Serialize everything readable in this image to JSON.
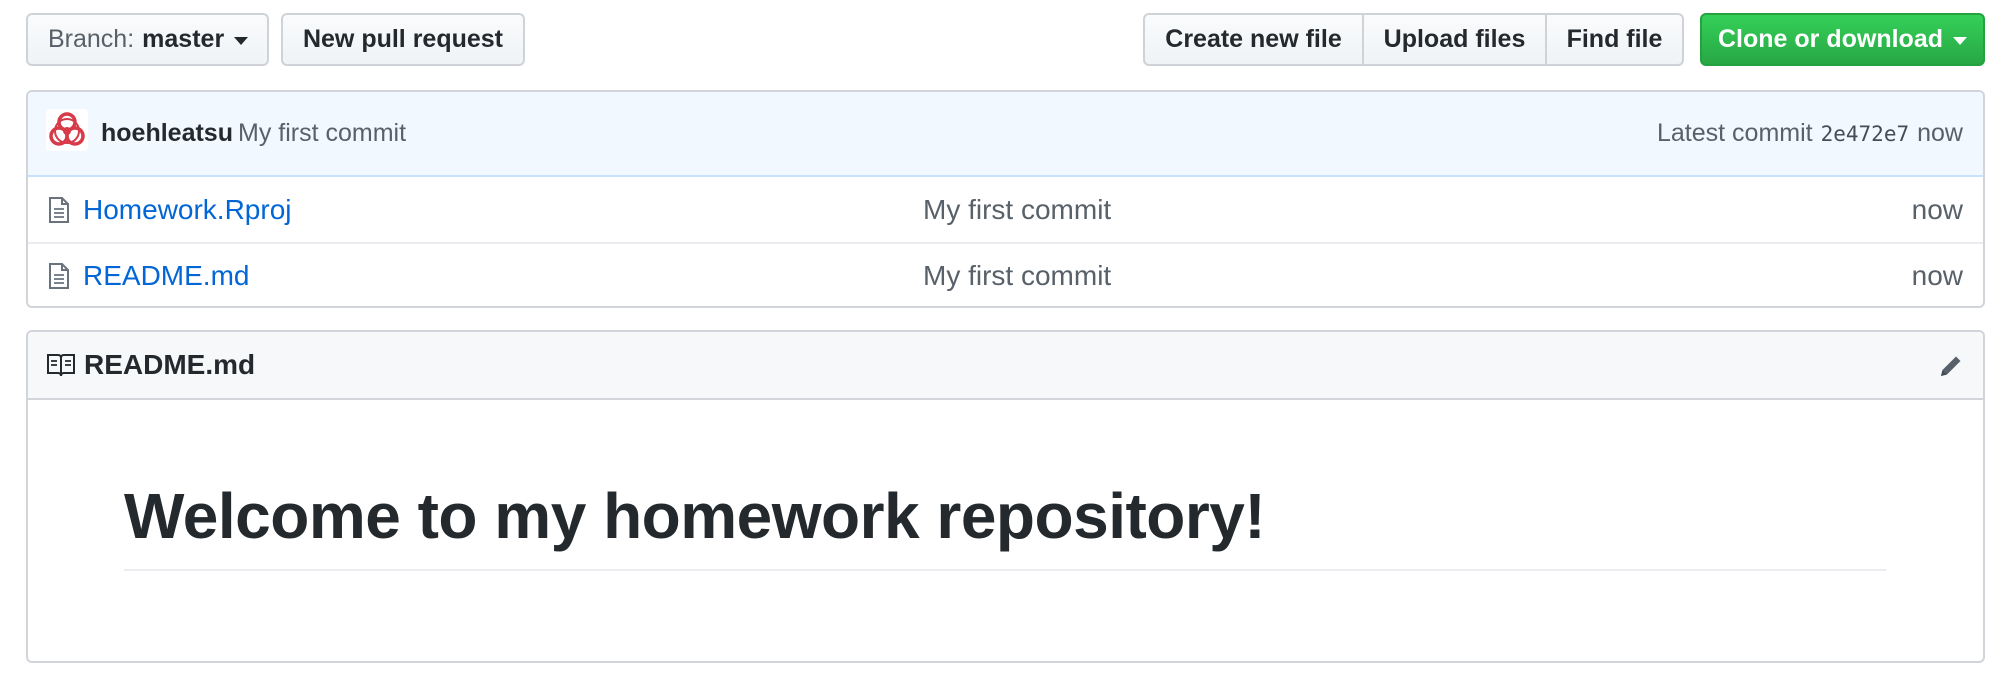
{
  "toolbar": {
    "branch_prefix": "Branch:",
    "branch_name": "master",
    "new_pr_label": "New pull request",
    "create_file_label": "Create new file",
    "upload_files_label": "Upload files",
    "find_file_label": "Find file",
    "clone_label": "Clone or download",
    "clone_color": "#28a745"
  },
  "commit": {
    "author": "hoehleatsu",
    "message": "My first commit",
    "latest_label": "Latest commit",
    "sha": "2e472e7",
    "time": "now"
  },
  "files": [
    {
      "name": "Homework.Rproj",
      "icon": "file-icon",
      "message": "My first commit",
      "age": "now"
    },
    {
      "name": "README.md",
      "icon": "file-icon",
      "message": "My first commit",
      "age": "now"
    }
  ],
  "readme": {
    "title": "README.md",
    "heading": "Welcome to my homework repository!"
  },
  "colors": {
    "link": "#0366d6",
    "commit_bar_bg": "#f1f8ff",
    "avatar_red": "#d73a49"
  }
}
